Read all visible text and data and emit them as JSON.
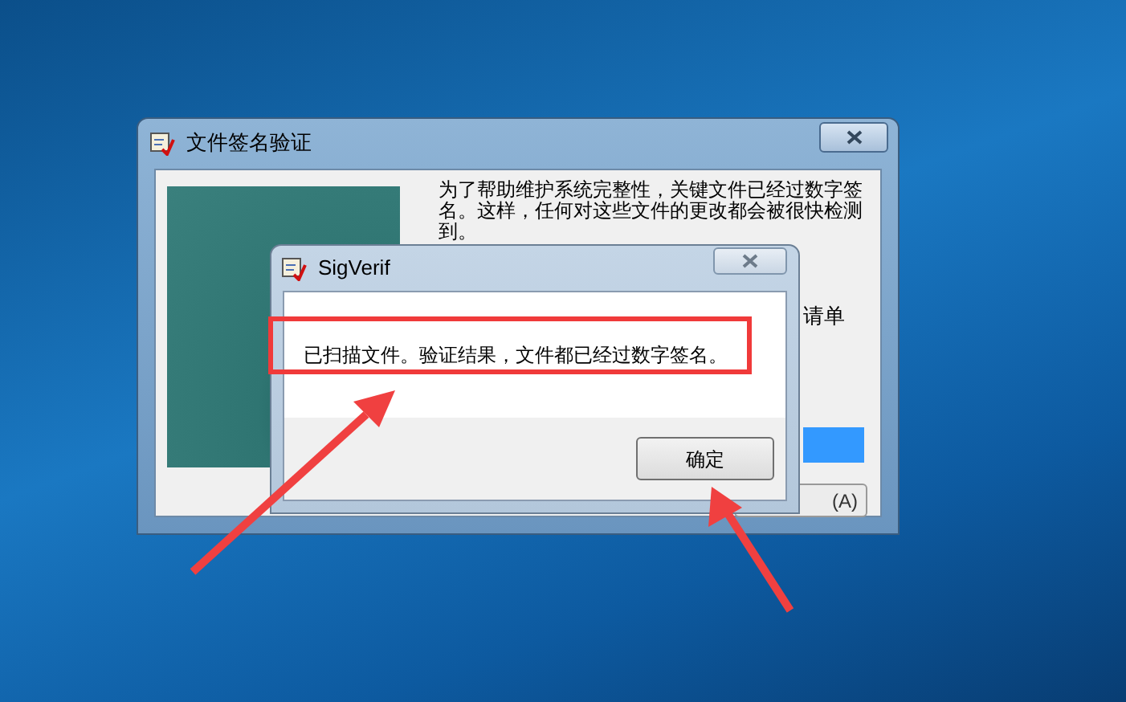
{
  "main_window": {
    "title": "文件签名验证",
    "description": "为了帮助维护系统完整性，关键文件已经过数字签名。这样，任何对这些文件的更改都会被很快检测到。",
    "side_text": "请单",
    "button_fragment": "(A)",
    "progress": {
      "level": 1
    }
  },
  "dialog": {
    "title": "SigVerif",
    "message": "已扫描文件。验证结果，文件都已经过数字签名。",
    "ok_button": "确定"
  }
}
